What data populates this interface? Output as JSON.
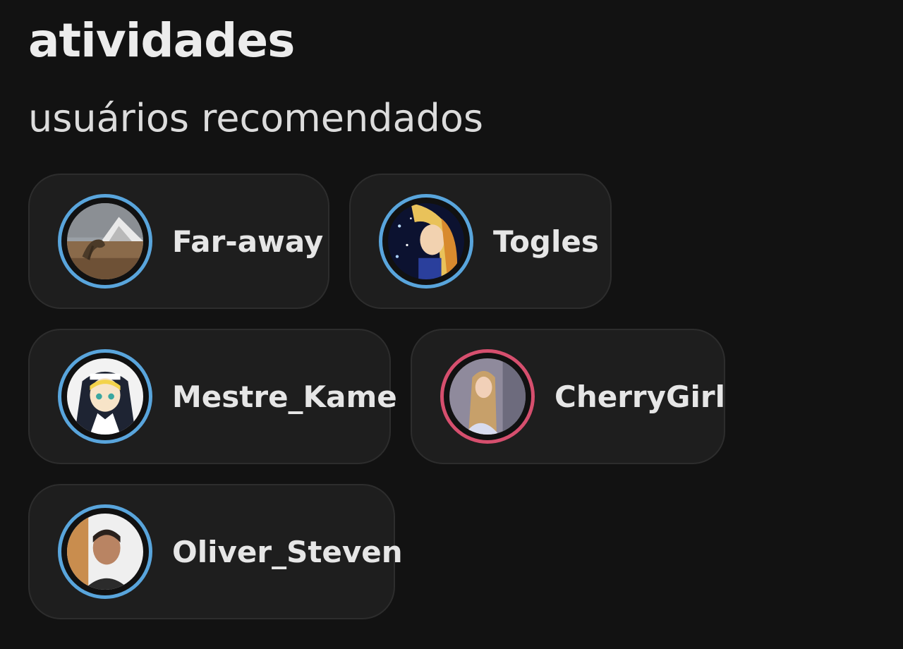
{
  "header": {
    "title": "atividades"
  },
  "recommended": {
    "title": "usuários recomendados",
    "users": [
      {
        "name": "Far-away",
        "ring_color": "#59a5dc"
      },
      {
        "name": "Togles",
        "ring_color": "#59a5dc"
      },
      {
        "name": "Mestre_Kame",
        "ring_color": "#59a5dc"
      },
      {
        "name": "CherryGirl",
        "ring_color": "#d64f6e"
      },
      {
        "name": "Oliver_Steven",
        "ring_color": "#59a5dc"
      }
    ]
  }
}
